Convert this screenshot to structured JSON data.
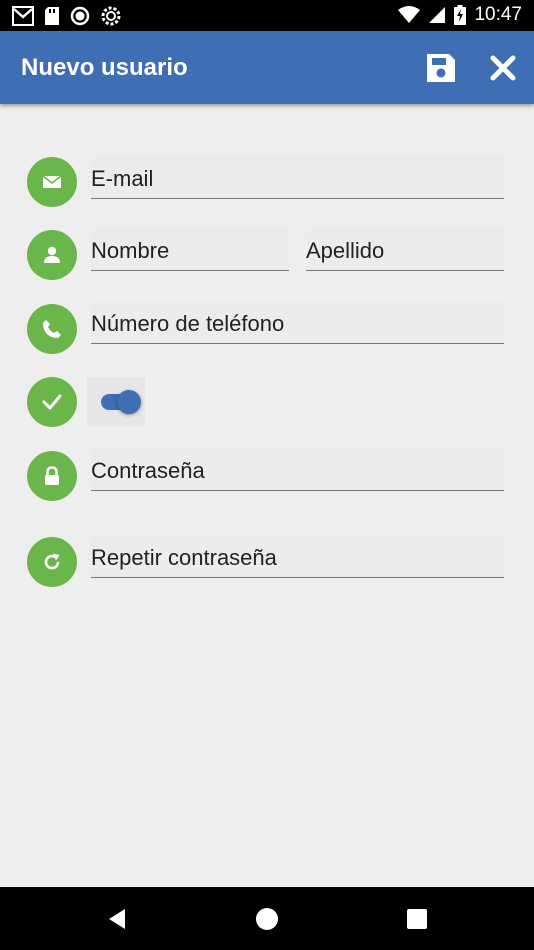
{
  "status_bar": {
    "time": "10:47",
    "left_icons": [
      "gmail-icon",
      "sd-card-icon",
      "circle-icon",
      "settings-sync-icon"
    ],
    "right_icons": [
      "wifi-icon",
      "signal-icon",
      "battery-charging-icon"
    ]
  },
  "app_bar": {
    "title": "Nuevo usuario",
    "actions": [
      "save-icon",
      "close-icon"
    ]
  },
  "form": {
    "email_placeholder": "E-mail",
    "first_name_placeholder": "Nombre",
    "last_name_placeholder": "Apellido",
    "phone_placeholder": "Número de teléfono",
    "active_toggle_on": true,
    "password_placeholder": "Contraseña",
    "repeat_password_placeholder": "Repetir contraseña"
  },
  "colors": {
    "primary": "#3f6eb5",
    "icon_circle": "#6bb64a",
    "background": "#eeeeee"
  },
  "nav_bar": {
    "buttons": [
      "back-icon",
      "home-icon",
      "recents-icon"
    ]
  }
}
